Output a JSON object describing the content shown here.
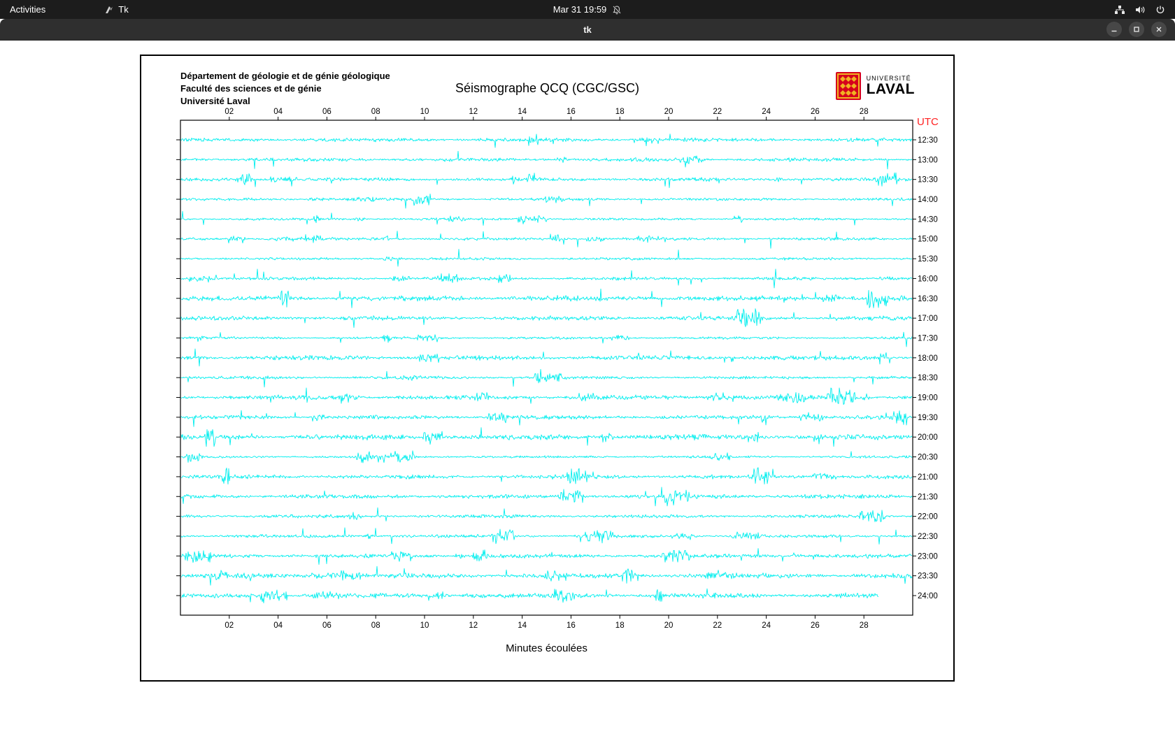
{
  "topbar": {
    "activities_label": "Activities",
    "app_label": "Tk",
    "clock": "Mar 31 19:59",
    "icons": {
      "app": "tk-app-icon",
      "notifications": "notifications-disabled-icon",
      "network": "network-icon",
      "volume": "volume-icon",
      "power": "power-icon"
    }
  },
  "titlebar": {
    "title": "tk",
    "icons": {
      "minimize": "minimize-icon",
      "maximize": "maximize-icon",
      "close": "close-icon"
    }
  },
  "header": {
    "institution_lines": [
      "Département de géologie et de génie géologique",
      "Faculté des sciences et de génie",
      "Université Laval"
    ],
    "title": "Séismographe QCQ (CGC/GSC)",
    "logo": {
      "top": "UNIVERSITÉ",
      "bottom": "LAVAL"
    }
  },
  "chart_data": {
    "type": "line",
    "title": "Séismographe QCQ (CGC/GSC)",
    "xlabel": "Minutes écoulées",
    "x_range_minutes": [
      0,
      30
    ],
    "x_ticks": [
      2,
      4,
      6,
      8,
      10,
      12,
      14,
      16,
      18,
      20,
      22,
      24,
      26,
      28
    ],
    "x_tick_labels": [
      "02",
      "04",
      "06",
      "08",
      "10",
      "12",
      "14",
      "16",
      "18",
      "20",
      "22",
      "24",
      "26",
      "28"
    ],
    "right_axis_label": "UTC",
    "right_axis_label_color": "#ff2222",
    "trace_color": "#00eeee",
    "axis_color": "#000000",
    "trace_labels": [
      "12:30",
      "13:00",
      "13:30",
      "14:00",
      "14:30",
      "15:00",
      "15:30",
      "16:00",
      "16:30",
      "17:00",
      "17:30",
      "18:00",
      "18:30",
      "19:00",
      "19:30",
      "20:00",
      "20:30",
      "21:00",
      "21:30",
      "22:00",
      "22:30",
      "23:00",
      "23:30",
      "24:00"
    ],
    "trace_interval_minutes": 30,
    "last_trace_end_minute": 28.6,
    "grid": false,
    "legend": "none"
  }
}
